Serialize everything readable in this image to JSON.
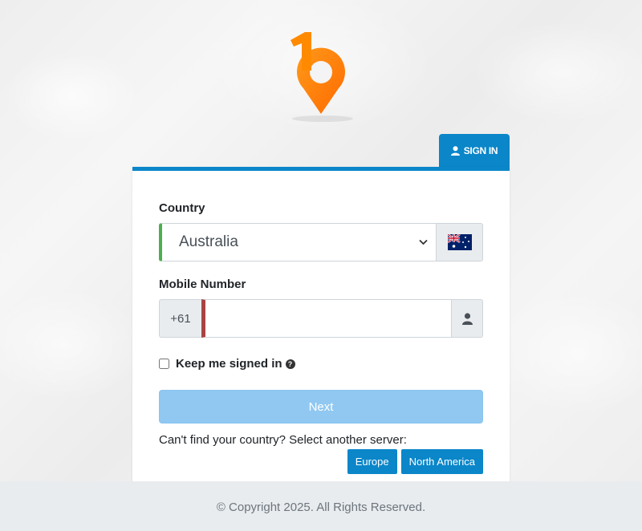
{
  "auth_tab": {
    "label": "SIGN IN",
    "icon": "user-icon"
  },
  "form": {
    "country_label": "Country",
    "country_value": "Australia",
    "country_flag": "australia-flag-icon",
    "mobile_label": "Mobile Number",
    "mobile_prefix": "+61",
    "mobile_value": "",
    "mobile_icon": "user-icon",
    "keep_signed_in_label": "Keep me signed in",
    "keep_signed_in_checked": false,
    "next_label": "Next",
    "server_prompt": "Can't find your country? Select another server:",
    "servers": [
      "Europe",
      "North America"
    ]
  },
  "footer": {
    "copyright": "© Copyright 2025. All Rights Reserved."
  },
  "colors": {
    "accent": "#0a86c9",
    "logo_orange": "#ff7a00",
    "next_disabled": "#90c8f2",
    "country_valid": "#4caf50",
    "mobile_invalid": "#a94442"
  }
}
